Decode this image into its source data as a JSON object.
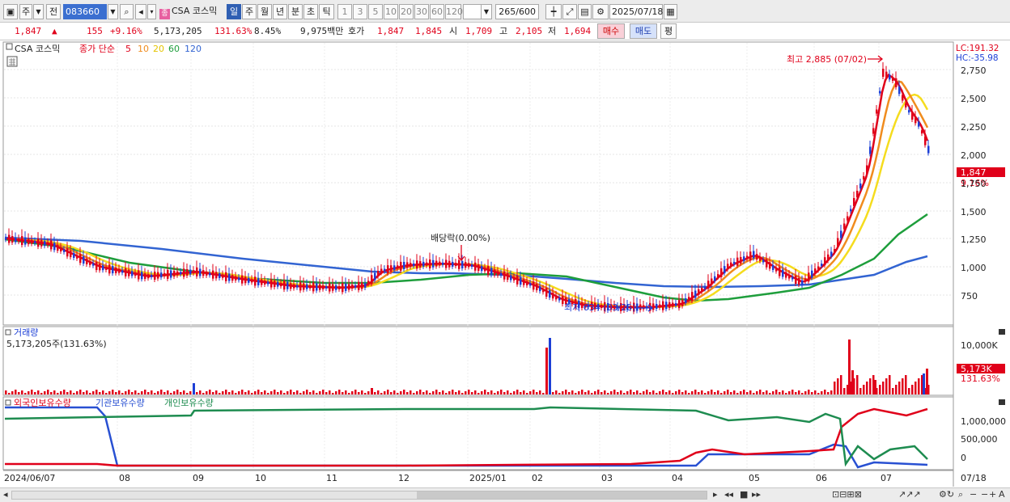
{
  "toolbar": {
    "market": "주",
    "tab_prev": "전",
    "code": "083660",
    "price_type": "종",
    "name": "CSA 코스믹",
    "periods": [
      "일",
      "주",
      "월",
      "년",
      "분",
      "초",
      "틱"
    ],
    "minute_steps": [
      "1",
      "3",
      "5",
      "10",
      "20",
      "30",
      "60",
      "120"
    ],
    "count": "265/600",
    "date": "2025/07/18"
  },
  "info": {
    "price": "1,847",
    "change": "155",
    "change_pct": "+9.16%",
    "volume": "5,173,205",
    "volume_ratio": "131.63%",
    "turnover": "8.45%",
    "amount": "9,975백만",
    "quote_label": "호가",
    "ask": "1,847",
    "bid": "1,845",
    "open_label": "시",
    "open": "1,709",
    "high_label": "고",
    "high": "2,105",
    "low_label": "저",
    "low": "1,694",
    "buy_label": "매수",
    "sell_label": "매도",
    "eval_label": "평"
  },
  "legend": {
    "name": "CSA 코스믹",
    "ma_label": "종가 단순",
    "ma_periods": [
      "5",
      "10",
      "20",
      "60",
      "120"
    ],
    "lc": "LC:191.32",
    "hc": "HC:-35.98",
    "high_note": "최고 2,885 (07/02)",
    "low_note": "최저 634 (03/25)",
    "dividend_note": "배당락(0.00%)",
    "last_price": "1,847",
    "last_pct": "9.16%"
  },
  "volume_panel": {
    "title": "거래량",
    "value": "5,173,205주(131.63%)",
    "axis": [
      "10,000K"
    ],
    "last": "5,173K",
    "last_pct": "131.63%"
  },
  "holding_panel": {
    "series_names": [
      "외국인보유수량",
      "기관보유수량",
      "개인보유수량"
    ],
    "axis": [
      "1,000,000",
      "500,000",
      "0"
    ]
  },
  "price_axis": [
    "2,750",
    "2,500",
    "2,250",
    "2,000",
    "1,750",
    "1,500",
    "1,250",
    "1,000",
    "750"
  ],
  "x_axis": [
    "2024/06/07",
    "08",
    "09",
    "10",
    "11",
    "12",
    "2025/01",
    "02",
    "03",
    "04",
    "05",
    "06",
    "07",
    "07/18"
  ],
  "colors": {
    "up": "#e0001a",
    "down": "#1d3fd6",
    "ma5": "#e0001a",
    "ma10": "#f08c1e",
    "ma20": "#f5dc1e",
    "ma60": "#1e9e3c",
    "ma120": "#3264d2",
    "foreign": "#e0001a",
    "inst": "#2850d2",
    "retail": "#1e8c50"
  }
}
